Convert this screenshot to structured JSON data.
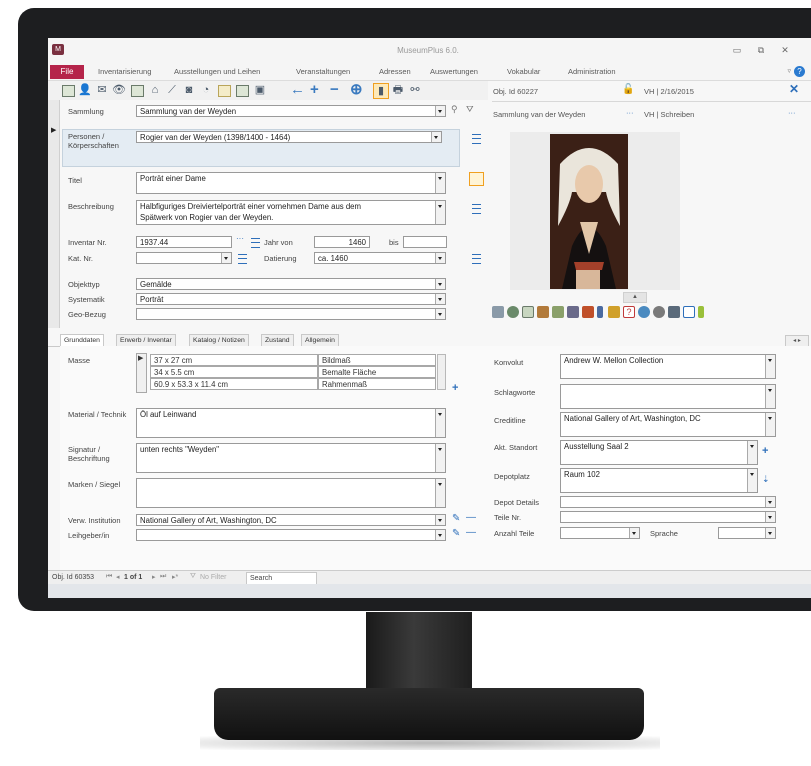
{
  "window": {
    "title": "MuseumPlus 6.0."
  },
  "ribbon": {
    "file": "File",
    "tabs": [
      "Inventarisierung",
      "Ausstellungen und Leihen",
      "Veranstaltungen",
      "Adressen",
      "Auswertungen",
      "Vokabular",
      "Administration"
    ]
  },
  "record_header": {
    "obj_id": "Obj. Id 60227",
    "user_date": "VH | 2/16/2015",
    "title": "Sammlung van der Weyden",
    "user_rights": "VH | Schreiben",
    "ellipsis": "···"
  },
  "form": {
    "sammlung": {
      "label": "Sammlung",
      "value": "Sammlung van der Weyden"
    },
    "personen": {
      "label": "Personen / Körperschaften",
      "value": "Rogier van der Weyden (1398/1400 - 1464)"
    },
    "titel": {
      "label": "Titel",
      "value": "Porträt einer Dame"
    },
    "beschreibung": {
      "label": "Beschreibung",
      "value1": "Halbfiguriges Dreiviertelporträt einer vornehmen Dame aus dem",
      "value2": "Spätwerk von Rogier van der Weyden."
    },
    "inventar": {
      "label": "Inventar Nr.",
      "value": "1937.44"
    },
    "jahr_von": {
      "label": "Jahr von",
      "value": "1460"
    },
    "bis": {
      "label": "bis",
      "value": ""
    },
    "kat": {
      "label": "Kat. Nr.",
      "value": ""
    },
    "datierung": {
      "label": "Datierung",
      "value": "ca. 1460"
    },
    "objekttyp": {
      "label": "Objekttyp",
      "value": "Gemälde"
    },
    "systematik": {
      "label": "Systematik",
      "value": "Porträt"
    },
    "geobezug": {
      "label": "Geo-Bezug",
      "value": ""
    },
    "ellipsis": "···"
  },
  "tabs": [
    "Grunddaten",
    "Erwerb / Inventar",
    "Katalog / Notizen",
    "Zustand",
    "Allgemein"
  ],
  "grunddaten": {
    "masse_label": "Masse",
    "masse": [
      {
        "value": "37 x 27 cm",
        "type": "Bildmaß"
      },
      {
        "value": "34 x 5.5 cm",
        "type": "Bemalte Fläche"
      },
      {
        "value": "60.9 x 53.3 x 11.4 cm",
        "type": "Rahmenmaß"
      }
    ],
    "material_label": "Material / Technik",
    "material": "Öl auf Leinwand",
    "signatur_label": "Signatur / Beschriftung",
    "signatur": "unten rechts \"Weyden\"",
    "marken_label": "Marken / Siegel",
    "marken": "",
    "verw_label": "Verw. Institution",
    "verw": "National Gallery of Art, Washington, DC",
    "leihgeber_label": "Leihgeber/in",
    "leihgeber": "",
    "konvolut_label": "Konvolut",
    "konvolut": "Andrew W. Mellon Collection",
    "schlagworte_label": "Schlagworte",
    "creditline_label": "Creditline",
    "creditline": "National Gallery of Art, Washington, DC",
    "standort_label": "Akt. Standort",
    "standort": "Ausstellung Saal 2",
    "depotplatz_label": "Depotplatz",
    "depotplatz": "Raum 102",
    "depotdetails_label": "Depot Details",
    "teile_label": "Teile Nr.",
    "anzahl_label": "Anzahl Teile",
    "sprache_label": "Sprache"
  },
  "statusbar": {
    "obj": "Obj. Id 60353",
    "record": "1 of 1",
    "nofilter": "No Filter",
    "search": "Search"
  },
  "colors": {
    "file_tab": "#b5244a",
    "accent": "#2e6fba",
    "bezel": "#1d1e20"
  }
}
